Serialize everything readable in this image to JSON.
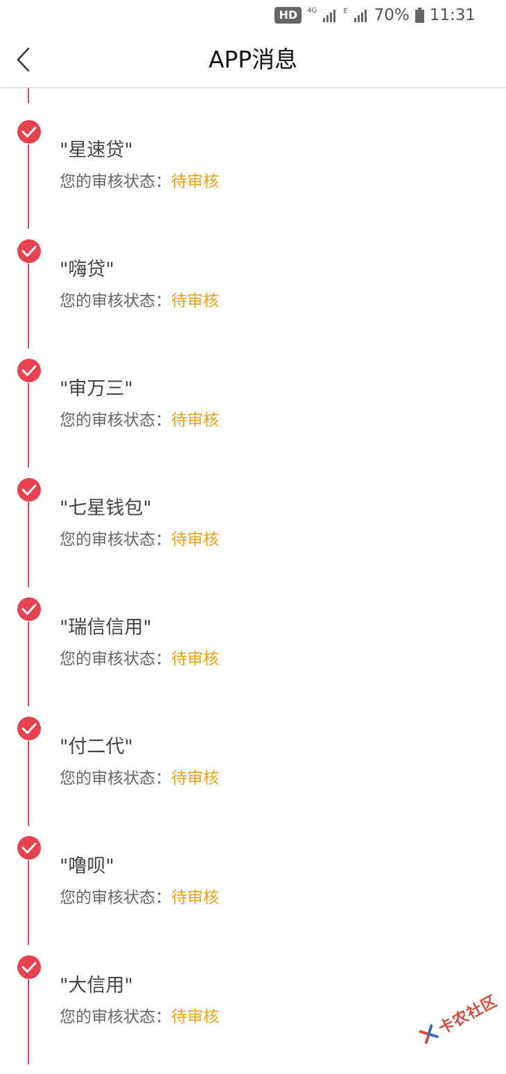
{
  "status_bar": {
    "hd": "HD",
    "network_4g": "4G",
    "network_e": "E",
    "battery": "70%",
    "time": "11:31"
  },
  "header": {
    "title": "APP消息"
  },
  "status_label": "您的审核状态：",
  "items": [
    {
      "name": "\"星速贷\"",
      "status": "待审核"
    },
    {
      "name": "\"嗨贷\"",
      "status": "待审核"
    },
    {
      "name": "\"审万三\"",
      "status": "待审核"
    },
    {
      "name": "\"七星钱包\"",
      "status": "待审核"
    },
    {
      "name": "\"瑞信信用\"",
      "status": "待审核"
    },
    {
      "name": "\"付二代\"",
      "status": "待审核"
    },
    {
      "name": "\"噜呗\"",
      "status": "待审核"
    },
    {
      "name": "\"大信用\"",
      "status": "待审核"
    }
  ],
  "watermark": {
    "text": "卡农社区"
  },
  "colors": {
    "accent": "#e5434f",
    "status": "#f0a116"
  }
}
